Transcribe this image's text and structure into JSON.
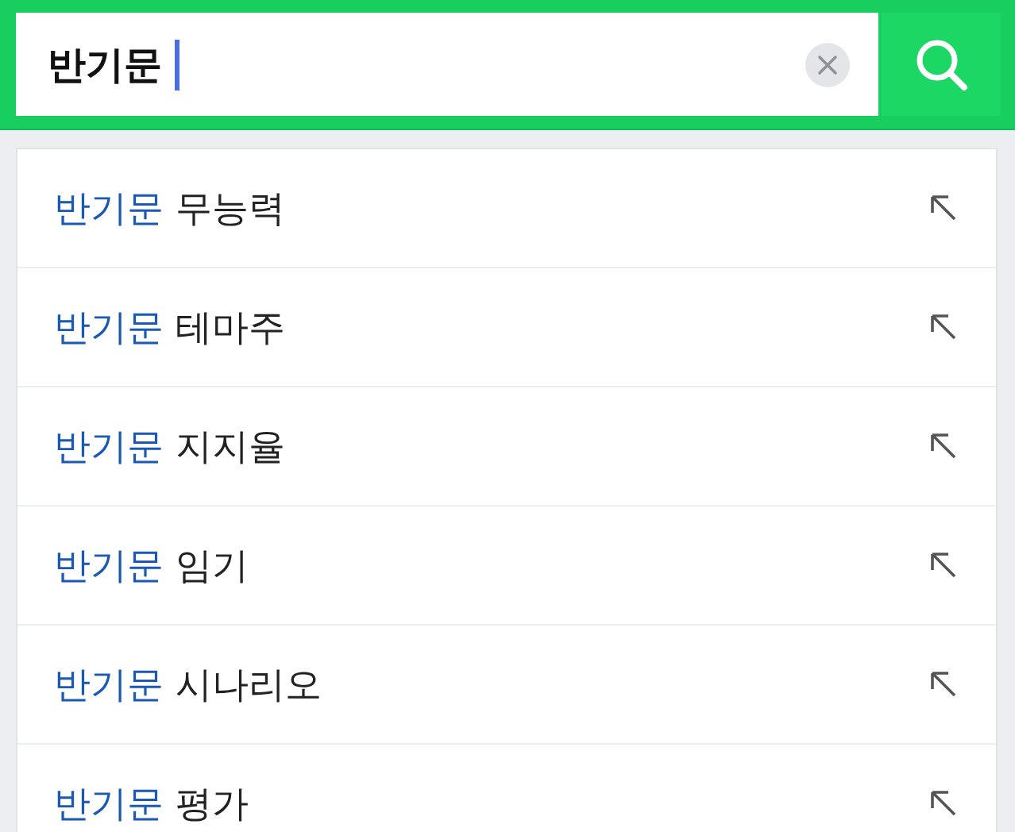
{
  "search": {
    "value": "반기문"
  },
  "suggestions": [
    {
      "match": "반기문",
      "rest": "무능력"
    },
    {
      "match": "반기문",
      "rest": "테마주"
    },
    {
      "match": "반기문",
      "rest": "지지율"
    },
    {
      "match": "반기문",
      "rest": "임기"
    },
    {
      "match": "반기문",
      "rest": "시나리오"
    },
    {
      "match": "반기문",
      "rest": "평가"
    }
  ]
}
